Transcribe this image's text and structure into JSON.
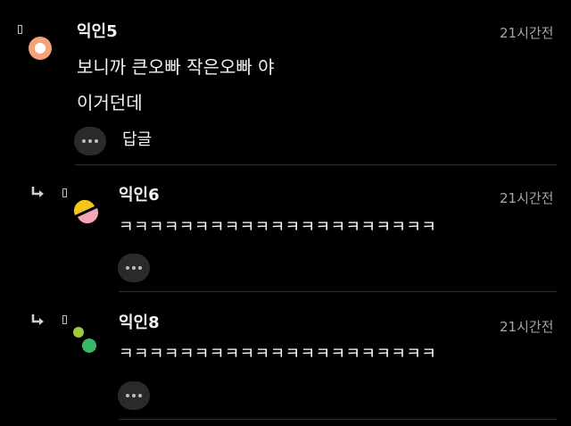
{
  "comments": [
    {
      "username": "익인5",
      "time": "21시간전",
      "lines": [
        "보니까 큰오빠 작은오빠 야",
        "이거던데"
      ],
      "reply_label": "답글",
      "avatar": {
        "icon": "orange-circle-avatar",
        "colors": [
          "#f4a27a",
          "#ffffff"
        ]
      }
    }
  ],
  "replies": [
    {
      "username": "익인6",
      "time": "21시간전",
      "text": "ㅋㅋㅋㅋㅋㅋㅋㅋㅋㅋㅋㅋㅋㅋㅋㅋㅋㅋㅋㅋㅋ",
      "avatar": {
        "icon": "yellow-pink-halfmoon-avatar",
        "colors": [
          "#f5c518",
          "#f4a6b8"
        ]
      }
    },
    {
      "username": "익인8",
      "time": "21시간전",
      "text": "ㅋㅋㅋㅋㅋㅋㅋㅋㅋㅋㅋㅋㅋㅋㅋㅋㅋㅋㅋㅋㅋ",
      "avatar": {
        "icon": "green-dots-avatar",
        "colors": [
          "#9ccc3c",
          "#3ab86a"
        ]
      }
    }
  ],
  "icons": {
    "reply_arrow": "reply-arrow-icon",
    "more": "more-dots-icon",
    "pin": "pin-icon"
  },
  "colors": {
    "background": "#000000",
    "text": "#f2f2f2",
    "muted": "#a6a6a6",
    "button_bg": "#2a2a2a",
    "divider": "#2e2e2e"
  }
}
